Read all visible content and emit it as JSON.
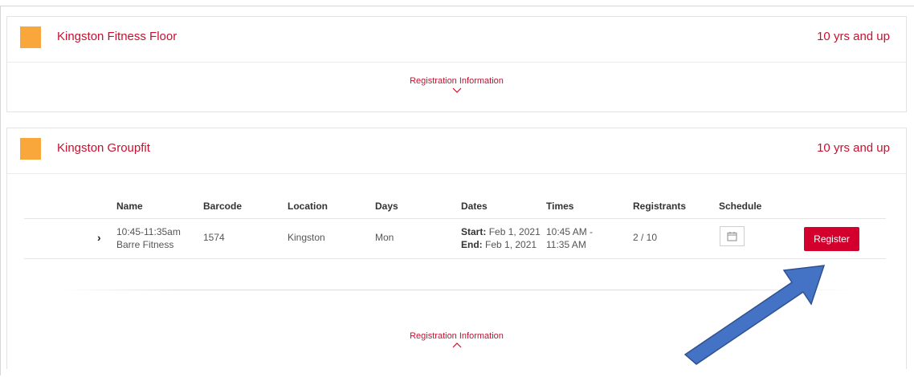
{
  "programs": [
    {
      "title": "Kingston Fitness Floor",
      "age": "10 yrs and up",
      "registration_info": "Registration Information",
      "expanded": false,
      "swatch_color": "#f9a73b"
    },
    {
      "title": "Kingston Groupfit",
      "age": "10 yrs and up",
      "registration_info": "Registration Information",
      "expanded": true,
      "swatch_color": "#f9a73b",
      "table": {
        "headers": {
          "name": "Name",
          "barcode": "Barcode",
          "location": "Location",
          "days": "Days",
          "dates": "Dates",
          "times": "Times",
          "registrants": "Registrants",
          "schedule": "Schedule"
        },
        "rows": [
          {
            "name_time": "10:45-11:35am",
            "name_title": "Barre Fitness",
            "barcode": "1574",
            "location": "Kingston",
            "days": "Mon",
            "start_label": "Start:",
            "start_date": "Feb 1, 2021",
            "end_label": "End:",
            "end_date": "Feb 1, 2021",
            "time_start": "10:45 AM -",
            "time_end": "11:35 AM",
            "registrants": "2 / 10",
            "register_label": "Register"
          }
        ]
      }
    }
  ],
  "colors": {
    "accent": "#c8102e",
    "register_button": "#d3002d",
    "swatch": "#f9a73b",
    "annotation_arrow": "#4472c4"
  },
  "icons": {
    "expand_row": "chevron-right-icon",
    "schedule": "calendar-icon",
    "collapsed": "chevron-down-icon",
    "expanded": "chevron-up-icon"
  }
}
